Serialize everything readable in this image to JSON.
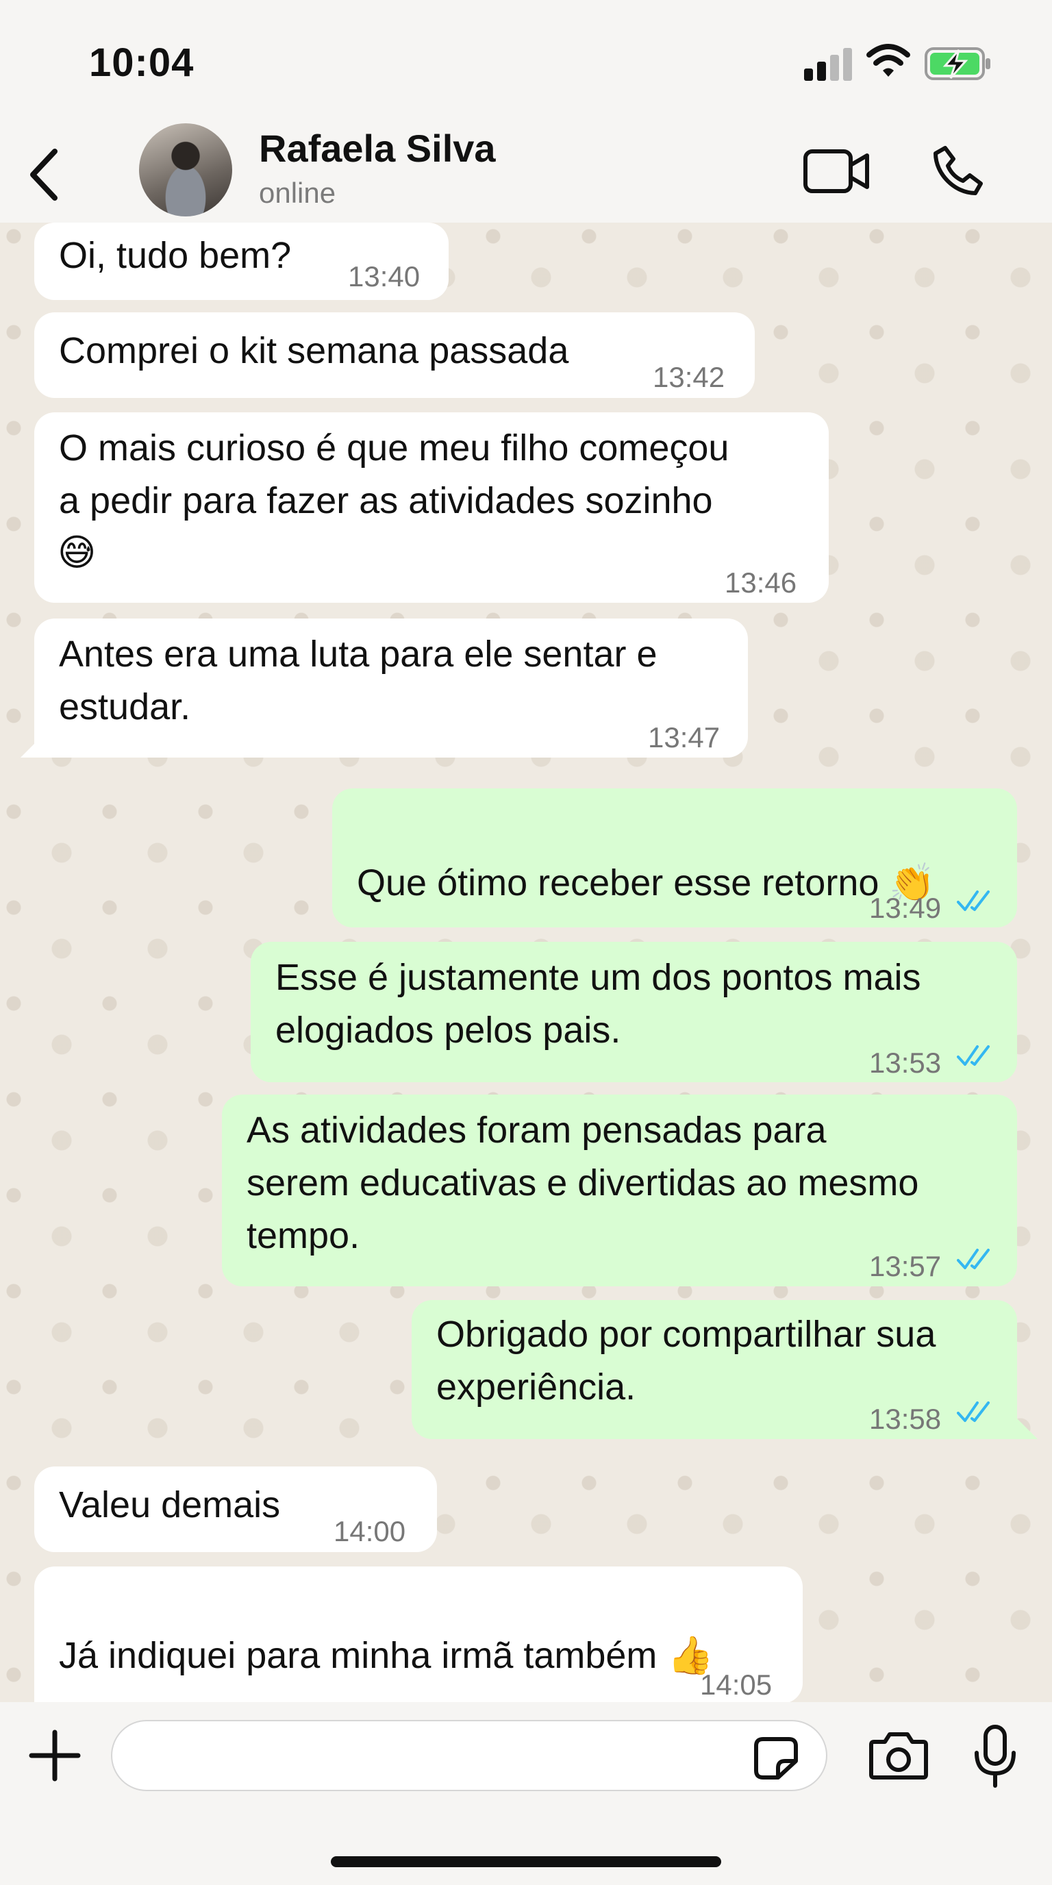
{
  "status_bar": {
    "time": "10:04",
    "battery_charging": true,
    "battery_color": "#4cd964"
  },
  "header": {
    "contact_name": "Rafaela Silva",
    "contact_status": "online"
  },
  "messages": [
    {
      "dir": "in",
      "text": "Oi, tudo bem?",
      "time": "13:40"
    },
    {
      "dir": "in",
      "text": "Comprei o kit semana passada",
      "time": "13:42"
    },
    {
      "dir": "in",
      "text": "O mais curioso é que meu filho começou\na pedir para fazer as atividades sozinho",
      "emoji": "😅",
      "time": "13:46"
    },
    {
      "dir": "in",
      "text": "Antes era uma luta para ele sentar e\nestudar.",
      "time": "13:47"
    },
    {
      "dir": "out",
      "text": "Que ótimo receber esse retorno",
      "emoji": "👏",
      "time": "13:49",
      "read": true
    },
    {
      "dir": "out",
      "text": "Esse é justamente um dos pontos mais\nelogiados pelos pais.",
      "time": "13:53",
      "read": true
    },
    {
      "dir": "out",
      "text": "As atividades foram pensadas para\nserem educativas e divertidas ao mesmo\ntempo.",
      "time": "13:57",
      "read": true
    },
    {
      "dir": "out",
      "text": "Obrigado por compartilhar sua\nexperiência.",
      "time": "13:58",
      "read": true
    },
    {
      "dir": "in",
      "text": "Valeu demais",
      "time": "14:00"
    },
    {
      "dir": "in",
      "text": "Já indiquei para minha irmã também",
      "emoji": "👍",
      "time": "14:05"
    }
  ],
  "input": {
    "placeholder": ""
  },
  "colors": {
    "incoming_bubble": "#ffffff",
    "outgoing_bubble": "#d9fdd3",
    "read_ticks": "#34b7f1",
    "background": "#efeae2"
  },
  "icons": [
    "back-arrow-icon",
    "video-call-icon",
    "phone-call-icon",
    "plus-icon",
    "sticker-icon",
    "camera-icon",
    "microphone-icon",
    "double-check-icon"
  ]
}
